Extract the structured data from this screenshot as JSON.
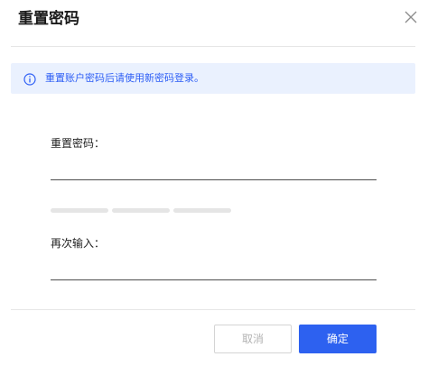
{
  "dialog": {
    "title": "重置密码",
    "close_icon": "close-icon"
  },
  "notice": {
    "icon": "info-icon",
    "text": "重置账户密码后请使用新密码登录。",
    "color": "#2e5ff5",
    "background": "#eaf1fe"
  },
  "form": {
    "password_label": "重置密码：",
    "password_value": "",
    "confirm_label": "再次输入：",
    "confirm_value": "",
    "strength_segments": 3
  },
  "footer": {
    "cancel_label": "取消",
    "confirm_label": "确定",
    "confirm_color": "#2d61f0"
  }
}
